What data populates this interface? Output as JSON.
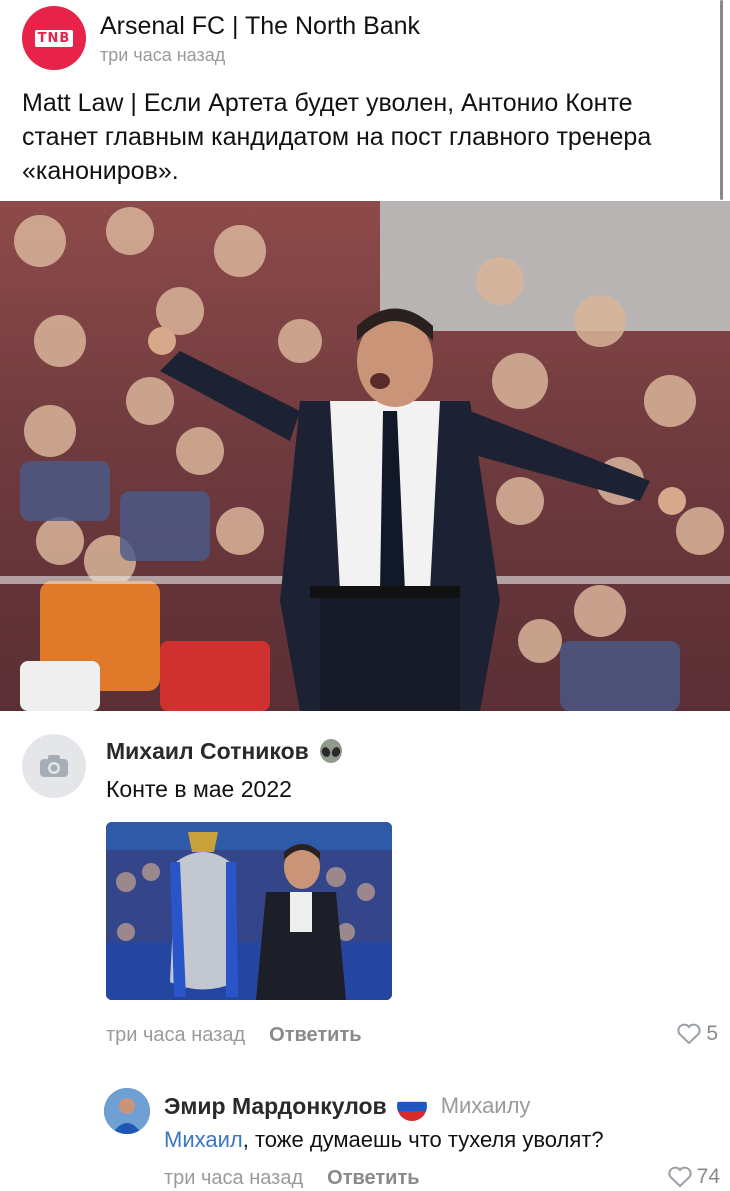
{
  "post": {
    "channel_name": "Arsenal FC | The North Bank",
    "avatar_text": "TNB",
    "time": "три часа назад",
    "text": "Matt Law | Если Артета будет уволен, Антонио Конте станет главным кандидатом на пост главного тренера «канониров»."
  },
  "comments": [
    {
      "author": "Михаил Сотников",
      "author_badge_icon": "alien-icon",
      "text": "Конте в мае 2022",
      "time": "три часа назад",
      "reply_label": "Ответить",
      "likes": "5"
    },
    {
      "author": "Эмир Мардонкулов",
      "author_badge_icon": "russia-flag-icon",
      "reply_to": "Михаилу",
      "mention": "Михаил",
      "text": ", тоже думаешь что тухеля уволят?",
      "time": "три часа назад",
      "reply_label": "Ответить",
      "likes": "74"
    }
  ],
  "colors": {
    "brand_red": "#e8234a",
    "mention_blue": "#3a76c4",
    "meta_gray": "#9a9a9a"
  }
}
